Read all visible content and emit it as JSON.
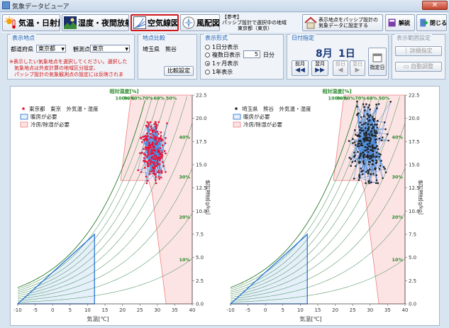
{
  "window": {
    "title": "気象データビューア",
    "close_label": "✕"
  },
  "toolbar": {
    "buttons": [
      {
        "label": "気温・日射量",
        "icon": "sun-thermometer-icon"
      },
      {
        "label": "湿度・夜間放射",
        "icon": "night-landscape-icon"
      },
      {
        "label": "空気線図",
        "icon": "psychrometric-chart-icon",
        "active": true
      },
      {
        "label": "風配図",
        "icon": "wind-rose-icon"
      }
    ],
    "info_lines": [
      "【参考】",
      "パッシブ設計で選択中の地域",
      "東京都（東京）"
    ],
    "set_button_lines": [
      "表示地点をパッシブ設計の",
      "気象データに設定する"
    ],
    "help_label": "解説",
    "close_label": "閉じる"
  },
  "panel_location": {
    "title": "表示地点",
    "pref_label": "都道府県",
    "pref_value": "東京都",
    "station_label": "観測点",
    "station_value": "東京",
    "note_lines": [
      "※表示したい気象地点を選択してください。選択した",
      "　気象地点は外皮計算の地域区分設定、",
      "　パッシブ設計の気象観測点の設定には反映されま"
    ]
  },
  "panel_compare": {
    "title": "地点比較",
    "location": "埼玉県　熊谷",
    "button": "比較設定"
  },
  "panel_format": {
    "title": "表示形式",
    "options": [
      "1日分表示",
      "複数日表示",
      "1ヶ月表示",
      "1年表示"
    ],
    "days_value": "5",
    "days_unit": "日分",
    "selected": "1ヶ月表示"
  },
  "panel_date": {
    "title": "日付指定",
    "month": "8月",
    "day": "1日",
    "prev_month": "前月",
    "next_month": "翌月",
    "prev_day": "前日",
    "next_day": "翌日",
    "specify": "指定日"
  },
  "panel_range": {
    "title": "表示範囲設定",
    "detail": "詳細指定",
    "auto": "自動調整"
  },
  "charts": [
    {
      "legend_station": "東京都　東京　外気温・湿度",
      "point_color": "#ee1133",
      "line_color": "#4488dd"
    },
    {
      "legend_station": "埼玉県　熊谷　外気温・湿度",
      "point_color": "#222222",
      "line_color": "#4488dd"
    }
  ],
  "legend": {
    "heating": "暖房が必要",
    "cooling": "冷房/除湿が必要"
  },
  "chart_data": [
    {
      "type": "scatter",
      "title": "",
      "xlabel": "気温[℃]",
      "ylabel": "絶対湿度[g/kg]",
      "top_label": "相対湿度[%]",
      "xlim": [
        -10,
        40
      ],
      "ylim": [
        0,
        22.5
      ],
      "x_ticks": [
        "-10",
        "-5",
        "0",
        "5",
        "10",
        "15",
        "20",
        "25",
        "30",
        "35",
        "40"
      ],
      "y_ticks": [
        "0.0",
        "2.5",
        "5.0",
        "7.5",
        "10.0",
        "12.5",
        "15.0",
        "17.5",
        "20.0",
        "22.5"
      ],
      "rh_curves": [
        10,
        20,
        30,
        40,
        50,
        60,
        70,
        80,
        90,
        100
      ],
      "rh_labels": [
        "100%",
        "90%",
        "80%",
        "70%",
        "60%",
        "50%",
        "40%",
        "30%",
        "20%",
        "10%"
      ],
      "series": [
        {
          "name": "東京都　東京　外気温・湿度",
          "x_range": [
            23.5,
            34.5
          ],
          "y_range": [
            13.0,
            19.6
          ],
          "y_center": 16.6
        }
      ]
    },
    {
      "type": "scatter",
      "title": "",
      "xlabel": "気温[℃]",
      "ylabel": "絶対湿度[g/kg]",
      "top_label": "相対湿度[%]",
      "xlim": [
        -10,
        40
      ],
      "ylim": [
        0,
        22.5
      ],
      "x_ticks": [
        "-10",
        "-5",
        "0",
        "5",
        "10",
        "15",
        "20",
        "25",
        "30",
        "35",
        "40"
      ],
      "y_ticks": [
        "0.0",
        "2.5",
        "5.0",
        "7.5",
        "10.0",
        "12.5",
        "15.0",
        "17.5",
        "20.0",
        "22.5"
      ],
      "rh_curves": [
        10,
        20,
        30,
        40,
        50,
        60,
        70,
        80,
        90,
        100
      ],
      "rh_labels": [
        "100%",
        "90%",
        "80%",
        "70%",
        "60%",
        "50%",
        "40%",
        "30%",
        "20%",
        "10%"
      ],
      "series": [
        {
          "name": "埼玉県　熊谷　外気温・湿度",
          "x_range": [
            22.0,
            37.0
          ],
          "y_range": [
            13.0,
            21.8
          ],
          "y_center": 17.3
        }
      ]
    }
  ]
}
